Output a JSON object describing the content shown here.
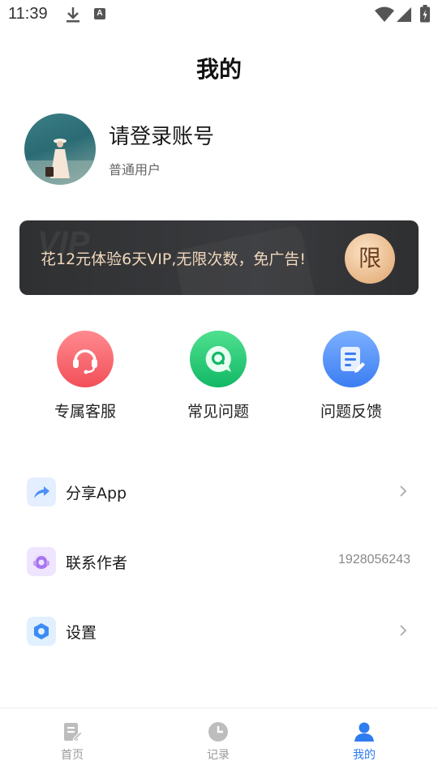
{
  "status_bar": {
    "time": "11:39",
    "icons": [
      "download-icon",
      "a-icon",
      "wifi-icon",
      "signal-icon",
      "battery-icon"
    ],
    "a_glyph": "A"
  },
  "header": {
    "title": "我的"
  },
  "profile": {
    "login_prompt": "请登录账号",
    "user_type": "普通用户"
  },
  "vip_banner": {
    "text": "花12元体验6天VIP,无限次数，免广告!",
    "badge": "限",
    "watermark": "VIP"
  },
  "quick_actions": [
    {
      "label": "专属客服",
      "icon": "headset-icon",
      "color": "#f24f59"
    },
    {
      "label": "常见问题",
      "icon": "question-bubble-icon",
      "color": "#12b866"
    },
    {
      "label": "问题反馈",
      "icon": "feedback-edit-icon",
      "color": "#3b7df2"
    }
  ],
  "menu": {
    "share": {
      "label": "分享App",
      "icon": "share-arrow-icon"
    },
    "contact": {
      "label": "联系作者",
      "value": "1928056243",
      "icon": "contact-author-icon"
    },
    "settings": {
      "label": "设置",
      "icon": "settings-hexagon-icon"
    }
  },
  "bottom_nav": {
    "home": {
      "label": "首页",
      "icon": "document-edit-icon"
    },
    "record": {
      "label": "记录",
      "icon": "clock-icon"
    },
    "mine": {
      "label": "我的",
      "icon": "person-icon",
      "active": true
    }
  },
  "colors": {
    "accent": "#2f7bf0",
    "vip_text": "#f0d8bc",
    "vip_bg": "#2f3032"
  }
}
